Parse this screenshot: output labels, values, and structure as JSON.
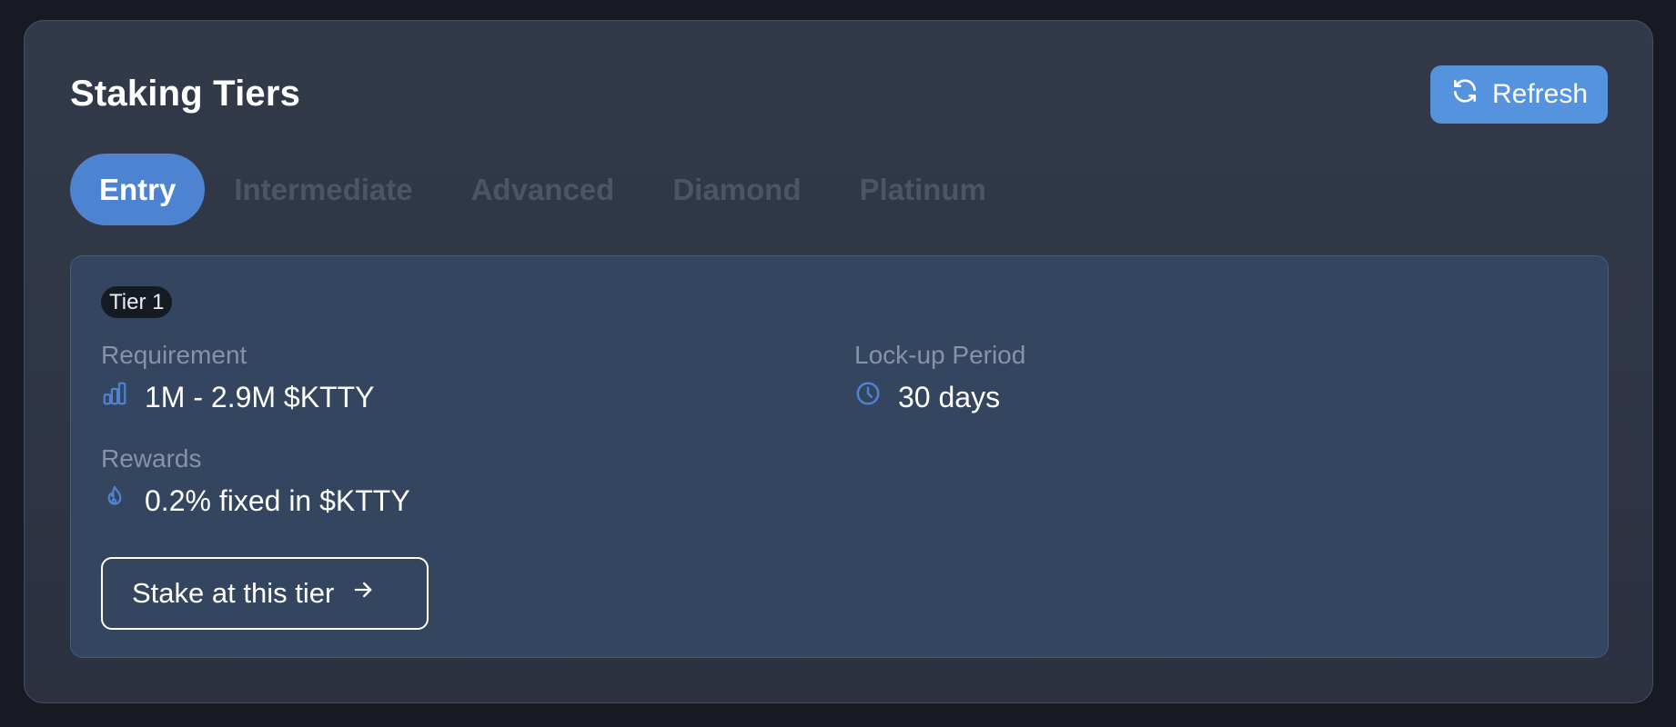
{
  "header": {
    "title": "Staking Tiers",
    "refresh_label": "Refresh",
    "refresh_icon": "refresh-icon"
  },
  "tabs": [
    {
      "label": "Entry",
      "active": true
    },
    {
      "label": "Intermediate",
      "active": false
    },
    {
      "label": "Advanced",
      "active": false
    },
    {
      "label": "Diamond",
      "active": false
    },
    {
      "label": "Platinum",
      "active": false
    }
  ],
  "tier": {
    "badge": "Tier 1",
    "requirement": {
      "label": "Requirement",
      "value": "1M - 2.9M $KTTY",
      "icon": "bar-chart-icon"
    },
    "lockup": {
      "label": "Lock-up Period",
      "value": "30 days",
      "icon": "clock-icon"
    },
    "rewards": {
      "label": "Rewards",
      "value": "0.2% fixed in $KTTY",
      "icon": "flame-icon"
    },
    "stake_label": "Stake at this tier",
    "stake_icon": "arrow-right-icon"
  },
  "colors": {
    "accent": "#5593df",
    "tab_active": "#4d83d1",
    "panel": "#34455f",
    "icon": "#4d83d1"
  }
}
